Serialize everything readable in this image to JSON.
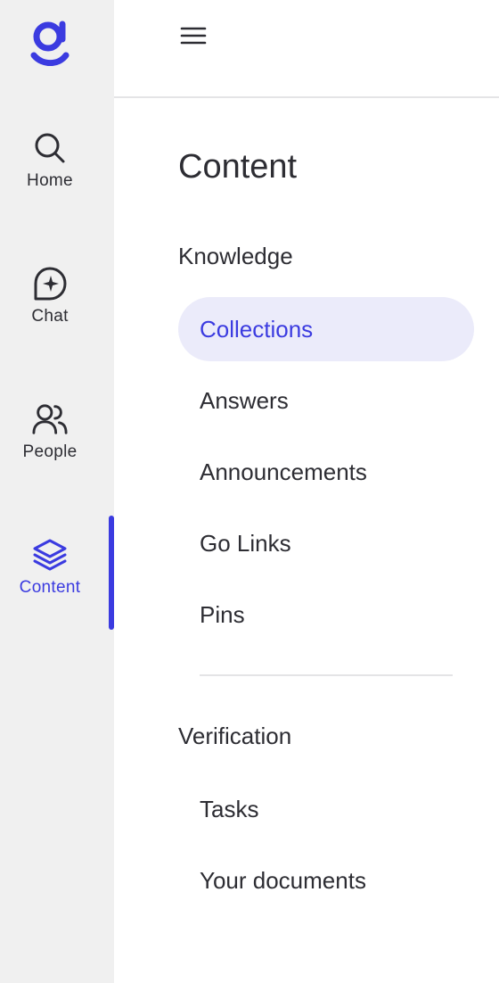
{
  "colors": {
    "accent": "#3b3be0",
    "rail_bg": "#f0f0f0",
    "selected_bg": "#ebebfa",
    "text": "#2d2d33",
    "divider": "#e4e4e6"
  },
  "rail": {
    "logo_icon": "brand-g-logo",
    "items": [
      {
        "label": "Home",
        "icon": "search-icon"
      },
      {
        "label": "Chat",
        "icon": "chat-sparkle-icon"
      },
      {
        "label": "People",
        "icon": "people-icon"
      },
      {
        "label": "Content",
        "icon": "layers-icon",
        "active": true
      }
    ]
  },
  "topbar": {
    "menu_icon": "hamburger-menu-icon"
  },
  "content_nav": {
    "title": "Content",
    "sections": [
      {
        "heading": "Knowledge",
        "items": [
          {
            "label": "Collections",
            "selected": true
          },
          {
            "label": "Answers"
          },
          {
            "label": "Announcements"
          },
          {
            "label": "Go Links"
          },
          {
            "label": "Pins"
          }
        ]
      },
      {
        "heading": "Verification",
        "items": [
          {
            "label": "Tasks"
          },
          {
            "label": "Your documents"
          }
        ]
      }
    ]
  }
}
